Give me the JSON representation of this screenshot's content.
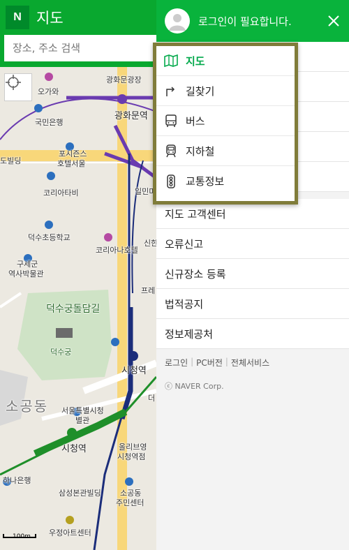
{
  "header": {
    "logo": "N",
    "title": "지도",
    "search_placeholder": "장소, 주소 검색"
  },
  "map": {
    "labels": {
      "gwanghwamun_square": "광화문광장",
      "ogapo": "오가와",
      "kookmin_bank": "국민은행",
      "gwanghwamun_station": "광화문역",
      "four_seasons": "포시즌스",
      "four_seasons_2": "호텔서울",
      "building": "도빌딩",
      "korea_times": "코리아타비",
      "ilmin": "일민미",
      "deoksu_school": "덕수초등학교",
      "korea_nahotel": "코리아나호텔",
      "sinhan": "신한",
      "old_council": "구세군",
      "old_council_2": "역사박물관",
      "fre": "프레",
      "deoksugung_wall": "덕수궁돌담길",
      "deoksugung": "덕수궁",
      "city_hall_station_1": "시청역",
      "sogong_dong": "소공동",
      "seoul_city_hall": "서울특별시청",
      "annex": "별관",
      "city_hall_station_2": "시청역",
      "olleebit": "올리브영",
      "olleebit_2": "시청역점",
      "hana_bank": "하나은행",
      "samsung_building": "삼성본관빌딩",
      "sogong_center": "소공동",
      "sogong_center_2": "주민센터",
      "woojeong": "우정아트센터",
      "de": "더"
    },
    "scale_label": "100m"
  },
  "panel": {
    "login_text": "로그인이 필요합니다.",
    "nav_items": [
      {
        "label": "지도",
        "icon": "map-icon",
        "active": true
      },
      {
        "label": "길찾기",
        "icon": "directions-icon",
        "active": false
      },
      {
        "label": "버스",
        "icon": "bus-icon",
        "active": false
      },
      {
        "label": "지하철",
        "icon": "subway-icon",
        "active": false
      },
      {
        "label": "교통정보",
        "icon": "traffic-light-icon",
        "active": false
      }
    ],
    "menu_items": [
      {
        "label": "지도 고객센터"
      },
      {
        "label": "오류신고"
      },
      {
        "label": "신규장소 등록"
      },
      {
        "label": "법적공지"
      },
      {
        "label": "정보제공처"
      }
    ],
    "footer_links": [
      "로그인",
      "PC버전",
      "전체서비스"
    ],
    "copyright": "ⓒ NAVER Corp."
  },
  "colors": {
    "brand_green": "#09b33c",
    "active_green": "#03a94b",
    "highlight_border": "#807c3a"
  }
}
